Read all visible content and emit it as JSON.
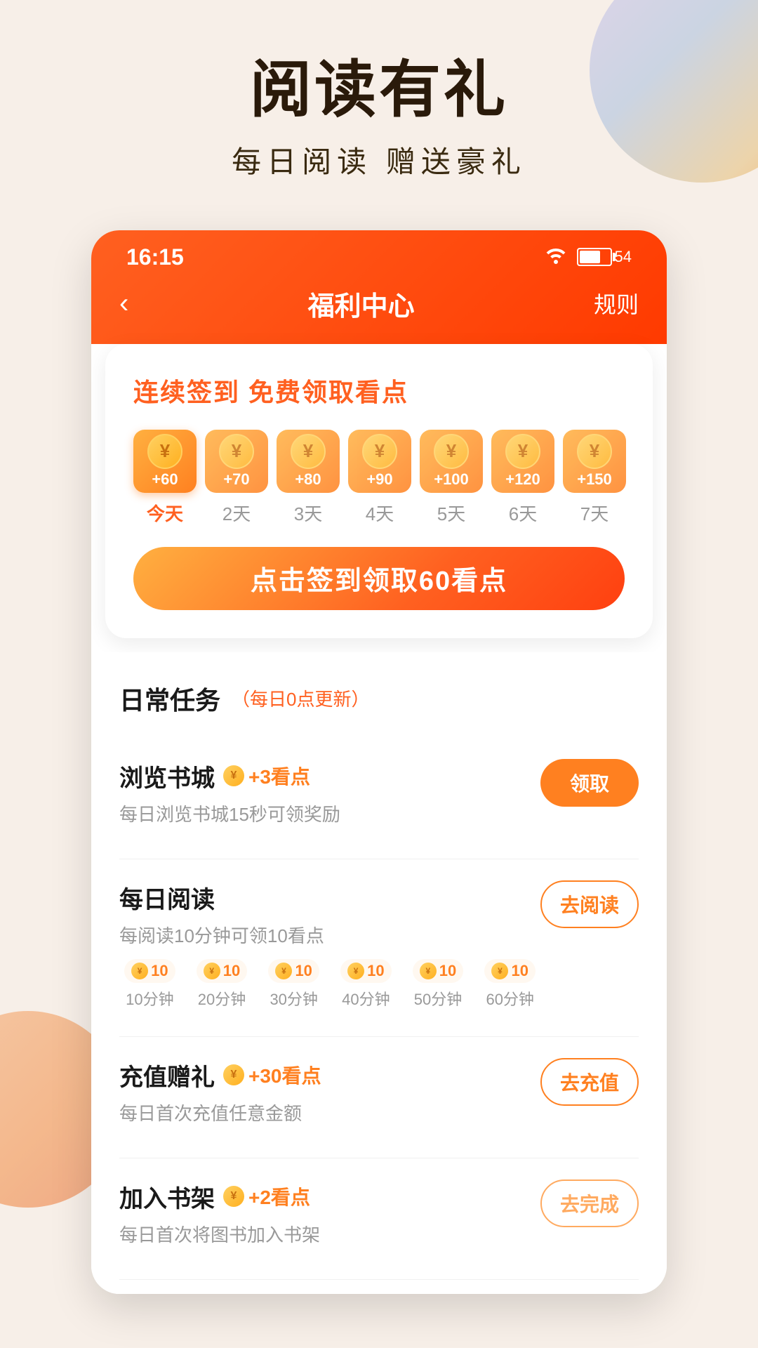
{
  "app": {
    "background_color": "#f7efe8"
  },
  "hero": {
    "title": "阅读有礼",
    "subtitle": "每日阅读  赠送豪礼"
  },
  "header": {
    "status_time": "16:15",
    "battery_level": "54",
    "nav_title": "福利中心",
    "nav_back_icon": "‹",
    "nav_rules": "规则"
  },
  "signin": {
    "section_title": "连续签到 免费领取看点",
    "btn_label": "点击签到领取60看点",
    "days": [
      {
        "amount": "+60",
        "label": "今天",
        "today": true
      },
      {
        "amount": "+70",
        "label": "2天",
        "today": false
      },
      {
        "amount": "+80",
        "label": "3天",
        "today": false
      },
      {
        "amount": "+90",
        "label": "4天",
        "today": false
      },
      {
        "amount": "+100",
        "label": "5天",
        "today": false
      },
      {
        "amount": "+120",
        "label": "6天",
        "today": false
      },
      {
        "amount": "+150",
        "label": "7天",
        "today": false
      }
    ]
  },
  "daily_tasks": {
    "section_title": "日常任务",
    "update_note": "（每日0点更新）",
    "tasks": [
      {
        "name": "浏览书城",
        "reward": "+3看点",
        "desc": "每日浏览书城15秒可领奖励",
        "action": "领取",
        "action_type": "orange-solid"
      },
      {
        "name": "每日阅读",
        "reward": "",
        "desc": "每阅读10分钟可领10看点",
        "action": "去阅读",
        "action_type": "orange-outline",
        "progress_coins": [
          "10",
          "10",
          "10",
          "10",
          "10",
          "10"
        ],
        "progress_times": [
          "10分钟",
          "20分钟",
          "30分钟",
          "40分钟",
          "50分钟",
          "60分钟"
        ]
      },
      {
        "name": "充值赠礼",
        "reward": "+30看点",
        "desc": "每日首次充值任意金额",
        "action": "去充值",
        "action_type": "orange-outline"
      },
      {
        "name": "加入书架",
        "reward": "+2看点",
        "desc": "每日首次将图书加入书架",
        "action": "去完成",
        "action_type": "gray-outline"
      }
    ]
  }
}
